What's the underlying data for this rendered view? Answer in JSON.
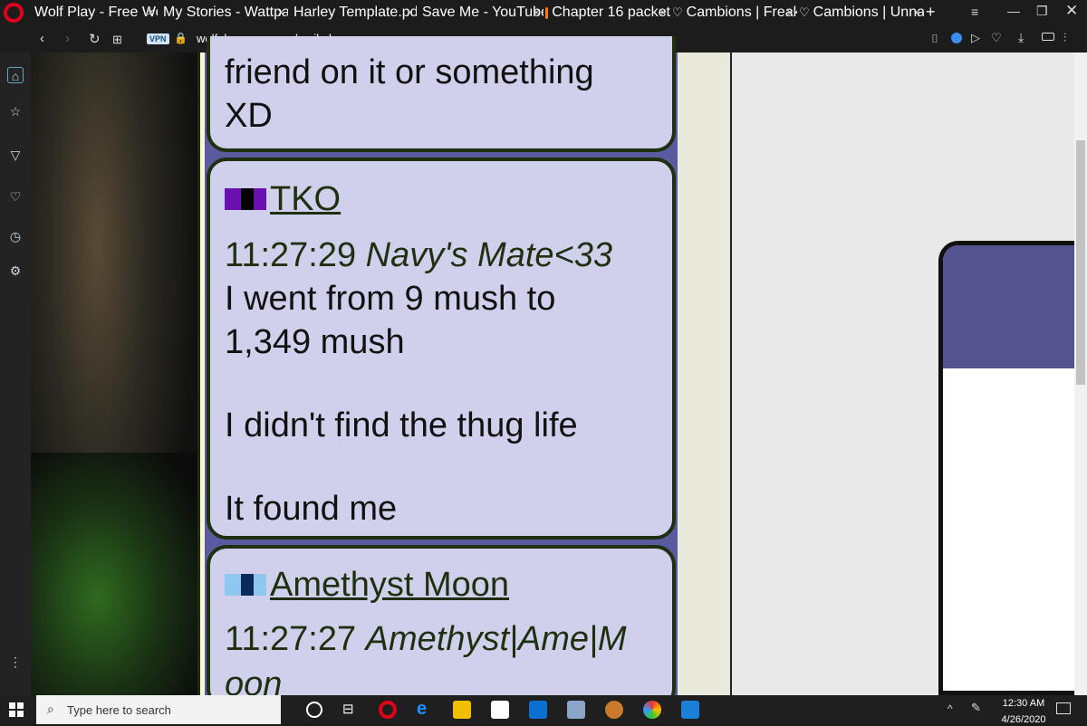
{
  "browser": {
    "tabs": [
      {
        "title": "Wolf Play - Free Wolf",
        "color": "#7b8fa8"
      },
      {
        "title": "My Stories - Wattpad",
        "color": "#ff7a00"
      },
      {
        "title": "Harley Template.pdf",
        "color": "#ffffff"
      },
      {
        "title": "Save Me - YouTube",
        "color": "#ff0000"
      },
      {
        "title": "Chapter 16 packet",
        "color": "#ff7a00"
      },
      {
        "title": "Cambions | Freaks Wi",
        "color": "#ffffff"
      },
      {
        "title": "Cambions | Unnatura",
        "color": "#ffffff"
      }
    ],
    "close_glyph": "×",
    "new_tab_glyph": "+",
    "vpn_label": "VPN",
    "url": "wolfplaygame.com/mail.php"
  },
  "messages": [
    {
      "lines": "friend on it or something XD"
    },
    {
      "sender": "TKO",
      "swatch_colors": [
        "#6a0fb0",
        "#000000",
        "#6a0fb0"
      ],
      "time": "11:27:29",
      "nick": "Navy's Mate<33",
      "text1": "I went from 9 mush to 1,349 mush",
      "text2": "I didn't find the thug life",
      "text3": "It found me"
    },
    {
      "sender": "Amethyst Moon",
      "swatch_colors": [
        "#8ec7f0",
        "#0b2a5c",
        "#8ec7f0"
      ],
      "time": "11:27:27",
      "nick": "Amethyst|Ame|M",
      "nick_cont": "oon"
    }
  ],
  "taskbar": {
    "search_placeholder": "Type here to search",
    "time": "12:30 AM",
    "date": "4/26/2020"
  },
  "colors": {
    "chat_bg": "#5a5aa0",
    "bubble_bg": "#d1d0ec",
    "bubble_border": "#1f3010",
    "card_header": "#535390"
  }
}
